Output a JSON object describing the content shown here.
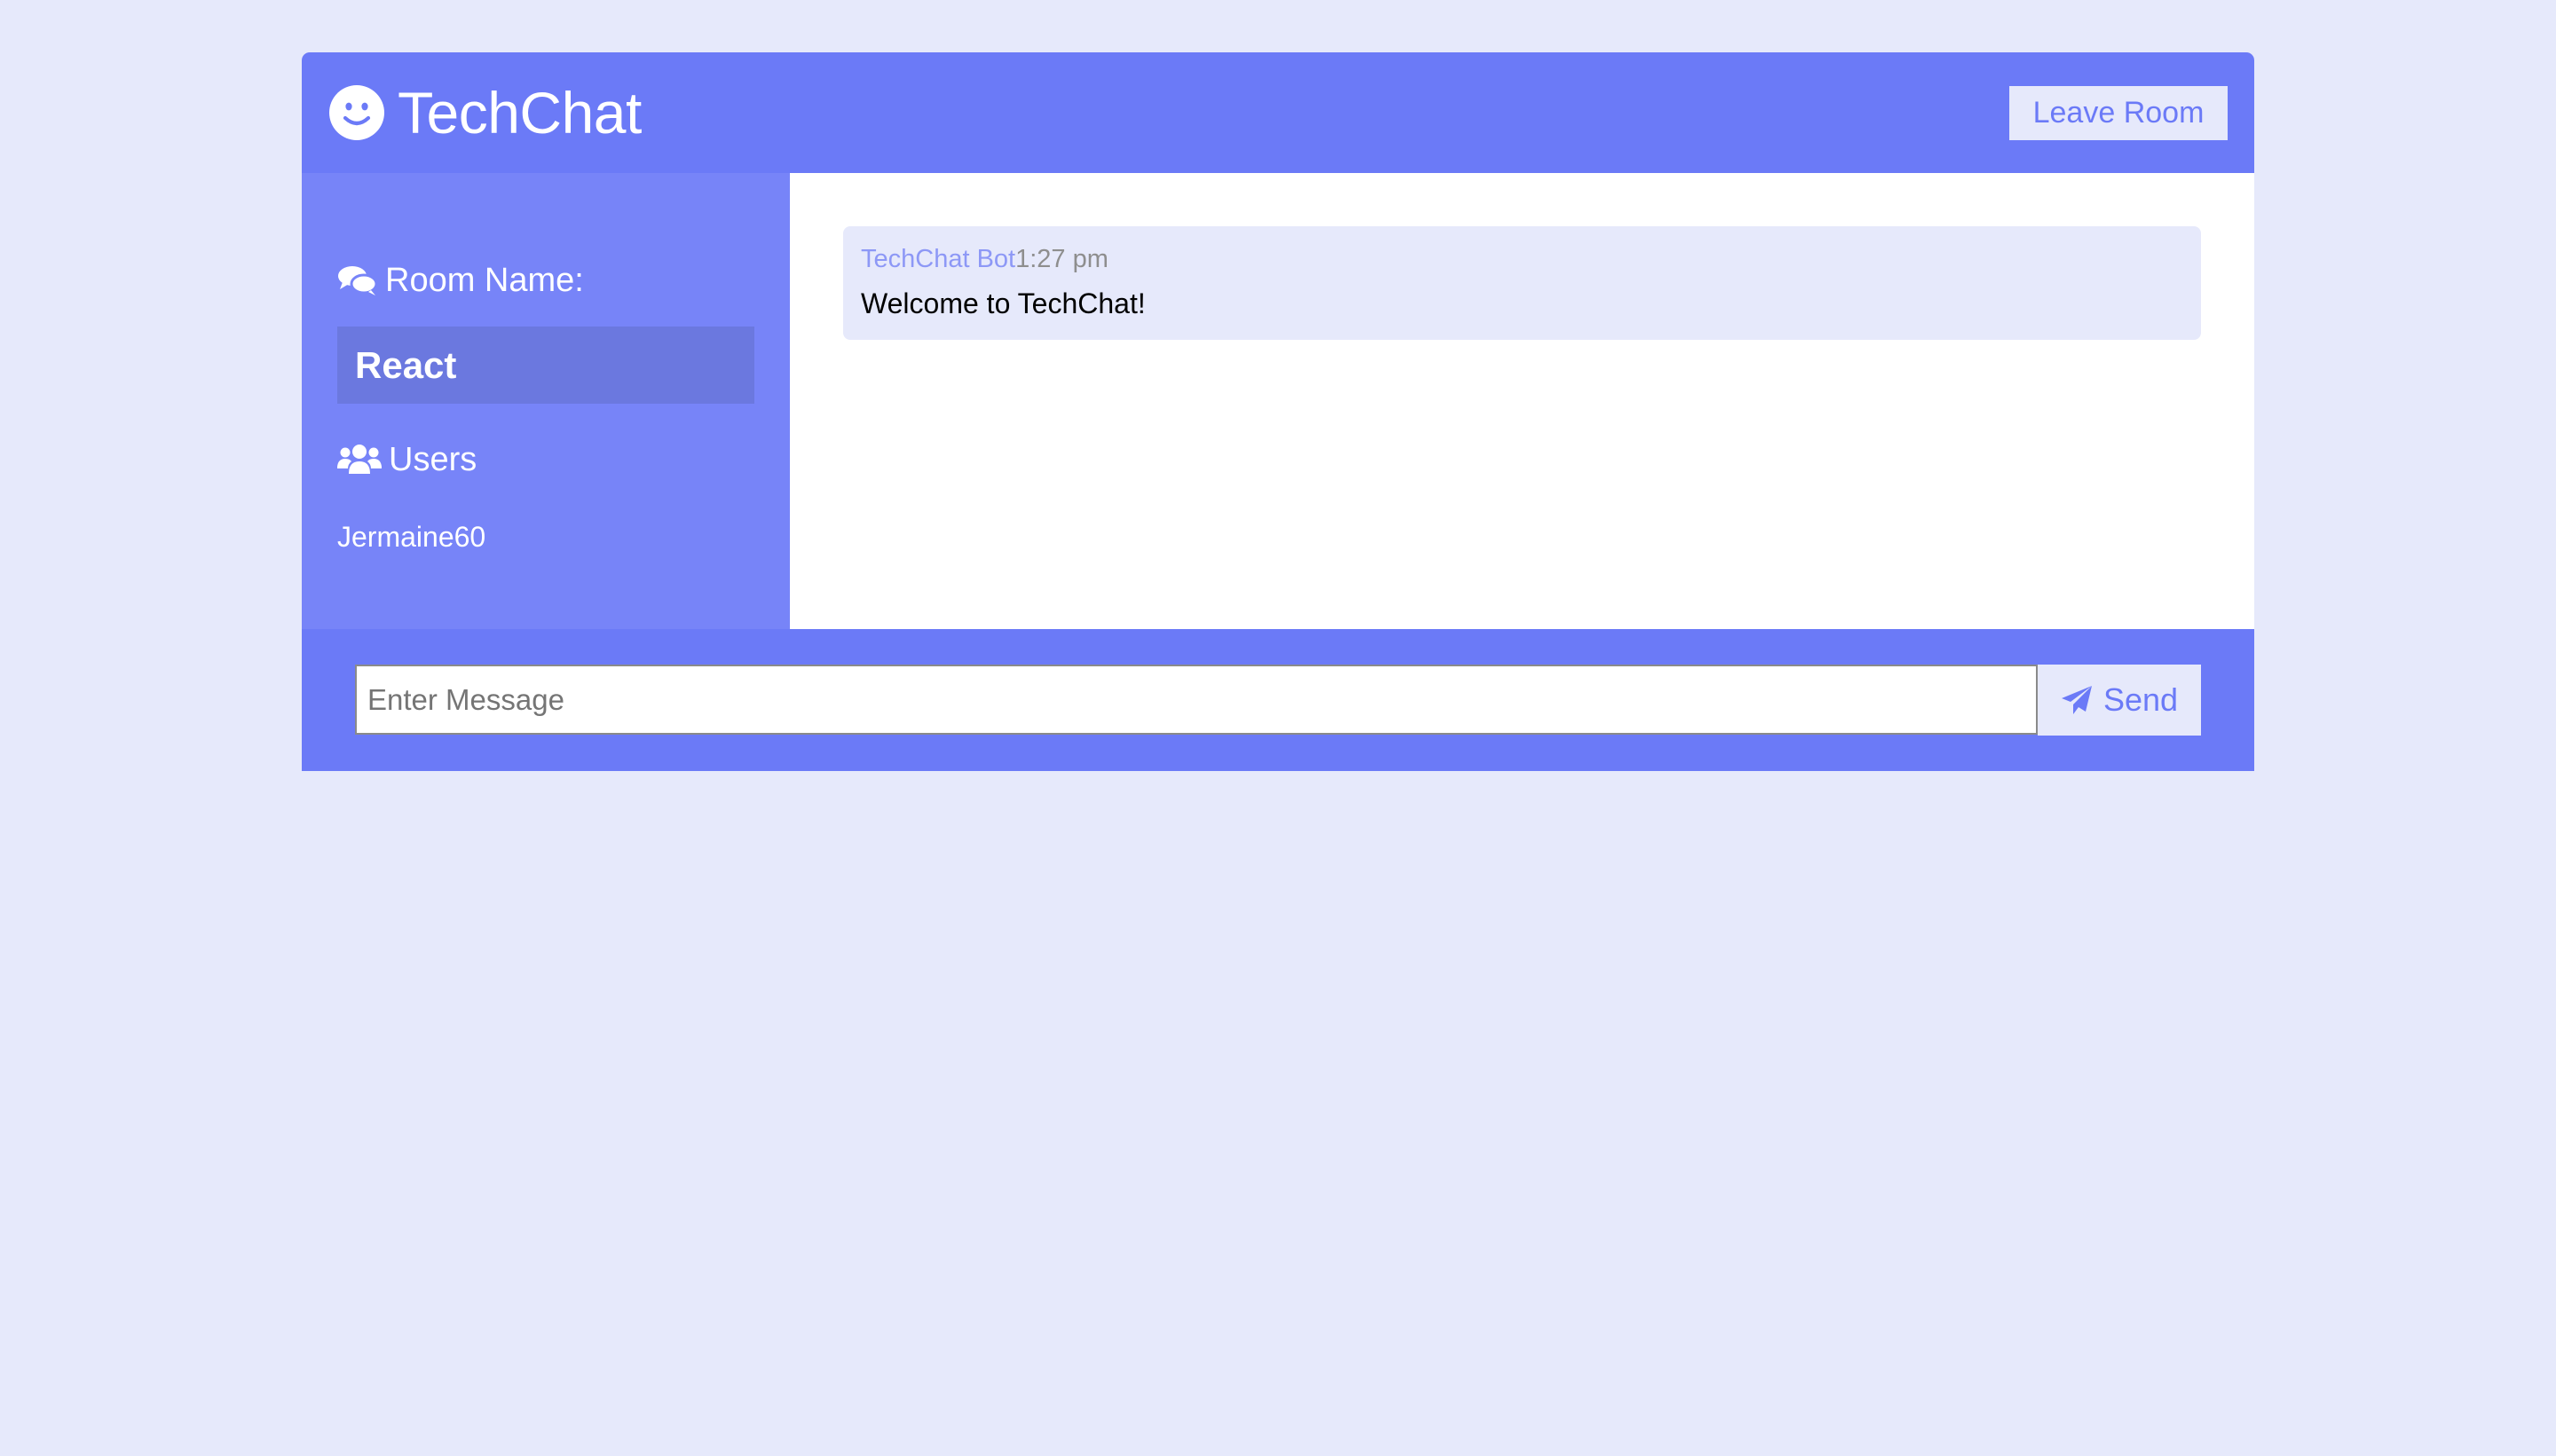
{
  "header": {
    "app_title": "TechChat",
    "logo_icon": "smile-icon",
    "leave_label": "Leave Room"
  },
  "sidebar": {
    "room_heading": "Room Name:",
    "room_heading_icon": "comments-icon",
    "room_name": "React",
    "users_heading": "Users",
    "users_heading_icon": "users-icon",
    "users": [
      "Jermaine60"
    ]
  },
  "messages": [
    {
      "username": "TechChat Bot",
      "time": "1:27 pm",
      "text": "Welcome to TechChat!"
    }
  ],
  "form": {
    "placeholder": "Enter Message",
    "value": "",
    "send_label": "Send",
    "send_icon": "paper-plane-icon"
  },
  "colors": {
    "background": "#e6e9fb",
    "primary": "#6b7af7",
    "sidebar": "#7784f8",
    "room_name_bg": "#6b78df",
    "bot_name": "#8d98f6",
    "time": "#8e8e8e"
  }
}
